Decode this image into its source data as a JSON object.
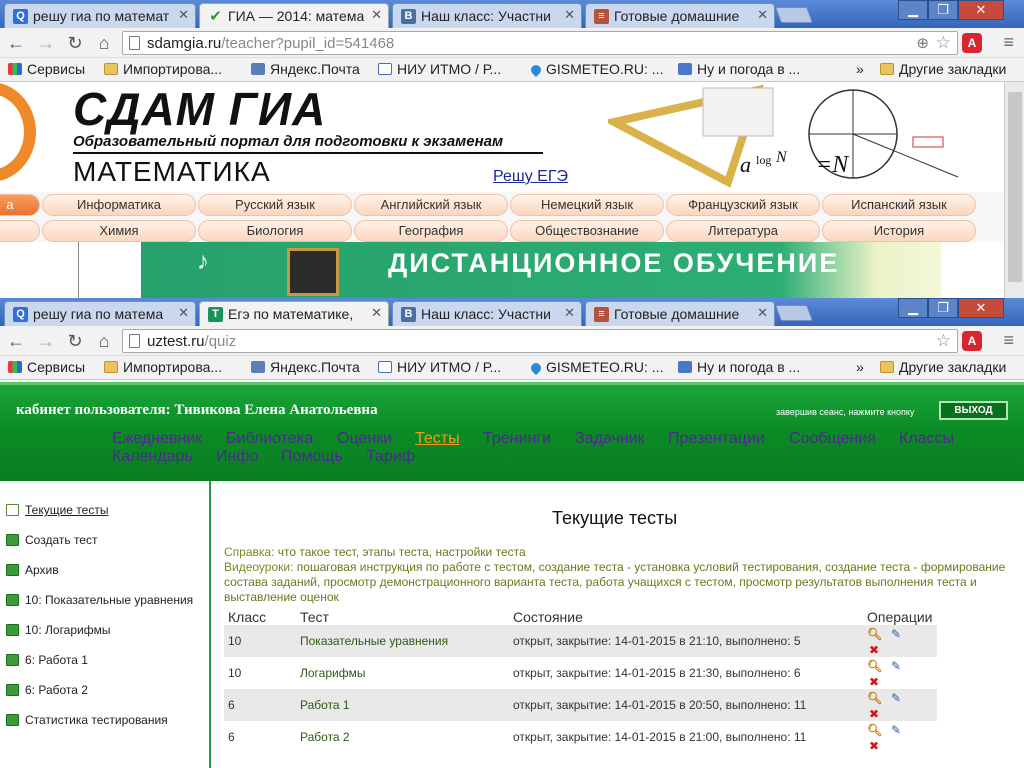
{
  "window1": {
    "tabs": [
      {
        "title": "решу гиа по математ",
        "favicon": "search-favicon",
        "active": false
      },
      {
        "title": "ГИА — 2014: матема",
        "favicon": "checkmark-favicon",
        "active": true
      },
      {
        "title": "Наш класс: Участни",
        "favicon": "vk-favicon",
        "active": false
      },
      {
        "title": "Готовые домашние",
        "favicon": "books-favicon",
        "active": false
      }
    ],
    "url_host": "sdamgia.ru",
    "url_path": "/teacher?pupil_id=541468",
    "site": {
      "title": "СДАМ ГИА",
      "subtitle": "Образовательный портал для подготовки к экзаменам",
      "subject": "МАТЕМАТИКА",
      "ege_link": "Решу ЕГЭ",
      "subjects_row1": [
        "а",
        "Информатика",
        "Русский язык",
        "Английский язык",
        "Немецкий язык",
        "Французский язык",
        "Испанский язык"
      ],
      "subjects_row2": [
        "",
        "Химия",
        "Биология",
        "География",
        "Обществознание",
        "Литература",
        "История"
      ],
      "banner_text": "ДИСТАНЦИОННОЕ ОБУЧЕНИЕ"
    }
  },
  "window2": {
    "tabs": [
      {
        "title": "решу гиа по матема",
        "favicon": "search-favicon",
        "active": false
      },
      {
        "title": "Егэ по математике, ",
        "favicon": "uztest-favicon",
        "active": true
      },
      {
        "title": "Наш класс: Участни",
        "favicon": "vk-favicon",
        "active": false
      },
      {
        "title": "Готовые домашние",
        "favicon": "books-favicon",
        "active": false
      }
    ],
    "url_host": "uztest.ru",
    "url_path": "/quiz"
  },
  "bookmarks": {
    "items": [
      "Сервисы",
      "Импортирова...",
      "Яндекс.Почта",
      "НИУ ИТМО / Р...",
      "GISMETEO.RU: ...",
      "Ну и погода в ..."
    ],
    "overflow": "»",
    "other": "Другие закладки"
  },
  "uztest": {
    "cabinet": "кабинет пользователя: Тивикова Елена Анатольевна",
    "exit_hint": "завершив сеанс, нажмите кнопку",
    "exit_label": "ВЫХОД",
    "nav_row1": [
      "Ежедневник",
      "Библиотека",
      "Оценки",
      "Тесты",
      "Тренинги",
      "Задачник",
      "Презентации",
      "Сообщения",
      "Классы"
    ],
    "nav_row2": [
      "Календарь",
      "Инфо",
      "Помощь",
      "Тариф"
    ],
    "active_nav": "Тесты",
    "sidebar": [
      "Текущие тесты",
      "Создать тест",
      "Архив",
      "10: Показательные уравнения",
      "10: Логарифмы",
      "6: Работа 1",
      "6: Работа 2",
      "Статистика тестирования"
    ],
    "page_title": "Текущие тесты",
    "help_label": "Справка:",
    "help_text": "что такое тест, этапы теста, настройки теста",
    "video_label": "Видеоуроки:",
    "video_text": "пошаговая инструкция по работе с тестом, создание теста - установка условий тестирования, создание теста - формирование состава заданий, просмотр демонстрационного варианта теста, работа учащихся с тестом, просмотр результатов выполнения теста и выставление оценок",
    "table": {
      "headers": [
        "Класс",
        "Тест",
        "Состояние",
        "Операции"
      ],
      "rows": [
        {
          "class": "10",
          "test": "Показательные уравнения",
          "state": "открыт, закрытие: 14-01-2015 в 21:10, выполнено: 5"
        },
        {
          "class": "10",
          "test": "Логарифмы",
          "state": "открыт, закрытие: 14-01-2015 в 21:30, выполнено: 6"
        },
        {
          "class": "6",
          "test": "Работа 1",
          "state": "открыт, закрытие: 14-01-2015 в 20:50, выполнено: 11"
        },
        {
          "class": "6",
          "test": "Работа 2",
          "state": "открыт, закрытие: 14-01-2015 в 21:00, выполнено: 11"
        }
      ]
    }
  }
}
